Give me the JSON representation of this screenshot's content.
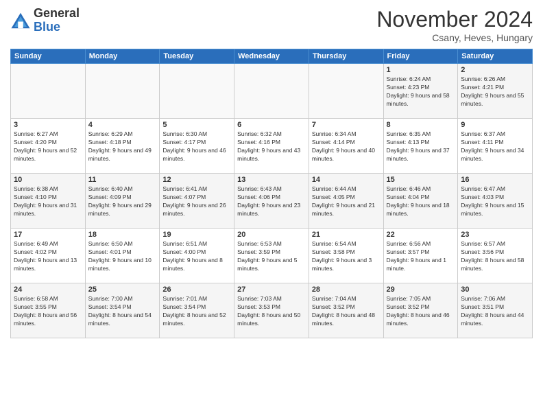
{
  "logo": {
    "general": "General",
    "blue": "Blue"
  },
  "title": "November 2024",
  "subtitle": "Csany, Heves, Hungary",
  "days_header": [
    "Sunday",
    "Monday",
    "Tuesday",
    "Wednesday",
    "Thursday",
    "Friday",
    "Saturday"
  ],
  "weeks": [
    [
      {
        "day": "",
        "info": ""
      },
      {
        "day": "",
        "info": ""
      },
      {
        "day": "",
        "info": ""
      },
      {
        "day": "",
        "info": ""
      },
      {
        "day": "",
        "info": ""
      },
      {
        "day": "1",
        "info": "Sunrise: 6:24 AM\nSunset: 4:23 PM\nDaylight: 9 hours and 58 minutes."
      },
      {
        "day": "2",
        "info": "Sunrise: 6:26 AM\nSunset: 4:21 PM\nDaylight: 9 hours and 55 minutes."
      }
    ],
    [
      {
        "day": "3",
        "info": "Sunrise: 6:27 AM\nSunset: 4:20 PM\nDaylight: 9 hours and 52 minutes."
      },
      {
        "day": "4",
        "info": "Sunrise: 6:29 AM\nSunset: 4:18 PM\nDaylight: 9 hours and 49 minutes."
      },
      {
        "day": "5",
        "info": "Sunrise: 6:30 AM\nSunset: 4:17 PM\nDaylight: 9 hours and 46 minutes."
      },
      {
        "day": "6",
        "info": "Sunrise: 6:32 AM\nSunset: 4:16 PM\nDaylight: 9 hours and 43 minutes."
      },
      {
        "day": "7",
        "info": "Sunrise: 6:34 AM\nSunset: 4:14 PM\nDaylight: 9 hours and 40 minutes."
      },
      {
        "day": "8",
        "info": "Sunrise: 6:35 AM\nSunset: 4:13 PM\nDaylight: 9 hours and 37 minutes."
      },
      {
        "day": "9",
        "info": "Sunrise: 6:37 AM\nSunset: 4:11 PM\nDaylight: 9 hours and 34 minutes."
      }
    ],
    [
      {
        "day": "10",
        "info": "Sunrise: 6:38 AM\nSunset: 4:10 PM\nDaylight: 9 hours and 31 minutes."
      },
      {
        "day": "11",
        "info": "Sunrise: 6:40 AM\nSunset: 4:09 PM\nDaylight: 9 hours and 29 minutes."
      },
      {
        "day": "12",
        "info": "Sunrise: 6:41 AM\nSunset: 4:07 PM\nDaylight: 9 hours and 26 minutes."
      },
      {
        "day": "13",
        "info": "Sunrise: 6:43 AM\nSunset: 4:06 PM\nDaylight: 9 hours and 23 minutes."
      },
      {
        "day": "14",
        "info": "Sunrise: 6:44 AM\nSunset: 4:05 PM\nDaylight: 9 hours and 21 minutes."
      },
      {
        "day": "15",
        "info": "Sunrise: 6:46 AM\nSunset: 4:04 PM\nDaylight: 9 hours and 18 minutes."
      },
      {
        "day": "16",
        "info": "Sunrise: 6:47 AM\nSunset: 4:03 PM\nDaylight: 9 hours and 15 minutes."
      }
    ],
    [
      {
        "day": "17",
        "info": "Sunrise: 6:49 AM\nSunset: 4:02 PM\nDaylight: 9 hours and 13 minutes."
      },
      {
        "day": "18",
        "info": "Sunrise: 6:50 AM\nSunset: 4:01 PM\nDaylight: 9 hours and 10 minutes."
      },
      {
        "day": "19",
        "info": "Sunrise: 6:51 AM\nSunset: 4:00 PM\nDaylight: 9 hours and 8 minutes."
      },
      {
        "day": "20",
        "info": "Sunrise: 6:53 AM\nSunset: 3:59 PM\nDaylight: 9 hours and 5 minutes."
      },
      {
        "day": "21",
        "info": "Sunrise: 6:54 AM\nSunset: 3:58 PM\nDaylight: 9 hours and 3 minutes."
      },
      {
        "day": "22",
        "info": "Sunrise: 6:56 AM\nSunset: 3:57 PM\nDaylight: 9 hours and 1 minute."
      },
      {
        "day": "23",
        "info": "Sunrise: 6:57 AM\nSunset: 3:56 PM\nDaylight: 8 hours and 58 minutes."
      }
    ],
    [
      {
        "day": "24",
        "info": "Sunrise: 6:58 AM\nSunset: 3:55 PM\nDaylight: 8 hours and 56 minutes."
      },
      {
        "day": "25",
        "info": "Sunrise: 7:00 AM\nSunset: 3:54 PM\nDaylight: 8 hours and 54 minutes."
      },
      {
        "day": "26",
        "info": "Sunrise: 7:01 AM\nSunset: 3:54 PM\nDaylight: 8 hours and 52 minutes."
      },
      {
        "day": "27",
        "info": "Sunrise: 7:03 AM\nSunset: 3:53 PM\nDaylight: 8 hours and 50 minutes."
      },
      {
        "day": "28",
        "info": "Sunrise: 7:04 AM\nSunset: 3:52 PM\nDaylight: 8 hours and 48 minutes."
      },
      {
        "day": "29",
        "info": "Sunrise: 7:05 AM\nSunset: 3:52 PM\nDaylight: 8 hours and 46 minutes."
      },
      {
        "day": "30",
        "info": "Sunrise: 7:06 AM\nSunset: 3:51 PM\nDaylight: 8 hours and 44 minutes."
      }
    ]
  ]
}
